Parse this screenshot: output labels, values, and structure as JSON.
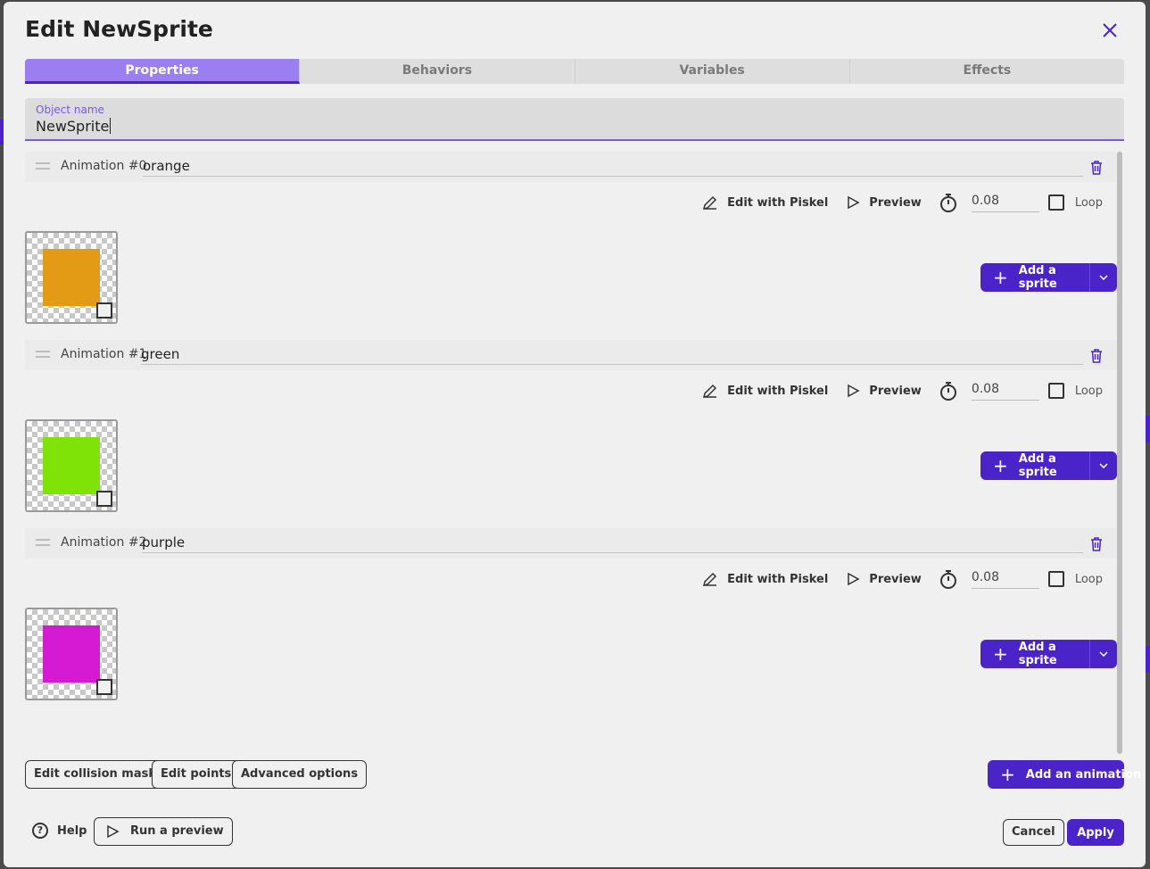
{
  "dialog": {
    "title": "Edit NewSprite",
    "close_icon": "close-icon"
  },
  "tabs": [
    {
      "label": "Properties",
      "active": true
    },
    {
      "label": "Behaviors",
      "active": false
    },
    {
      "label": "Variables",
      "active": false
    },
    {
      "label": "Effects",
      "active": false
    }
  ],
  "object_name": {
    "label": "Object name",
    "value": "NewSprite"
  },
  "animation_tools": {
    "edit_label": "Edit with Piskel",
    "preview_label": "Preview",
    "loop_label": "Loop",
    "add_sprite_label": "Add a sprite"
  },
  "animations": [
    {
      "label": "Animation #0",
      "name": "orange",
      "duration": "0.08",
      "loop": false,
      "sprite_color": "#e39a14"
    },
    {
      "label": "Animation #1",
      "name": "green",
      "duration": "0.08",
      "loop": false,
      "sprite_color": "#80e307"
    },
    {
      "label": "Animation #2",
      "name": "purple",
      "duration": "0.08",
      "loop": false,
      "sprite_color": "#d61ad4"
    }
  ],
  "footer": {
    "edit_collision_masks": "Edit collision masks",
    "edit_points": "Edit points",
    "advanced_options": "Advanced options",
    "add_animation": "Add an animation",
    "help": "Help",
    "run_preview": "Run a preview",
    "cancel": "Cancel",
    "apply": "Apply"
  },
  "colors": {
    "accent": "#4b24c9",
    "tab_active": "#9b7ff0"
  }
}
